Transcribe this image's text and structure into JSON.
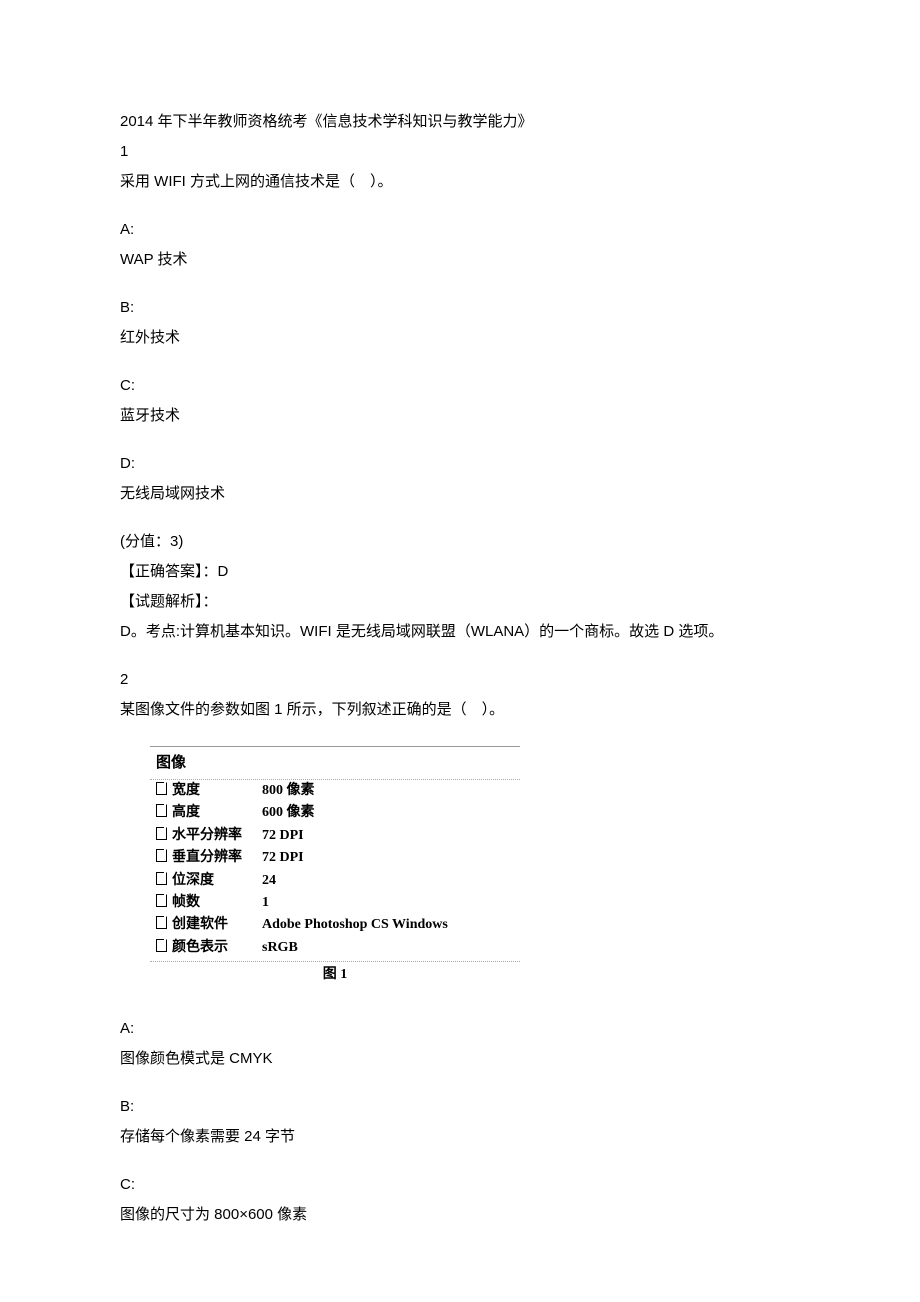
{
  "header": {
    "title": "2014 年下半年教师资格统考《信息技术学科知识与教学能力》"
  },
  "q1": {
    "num": "1",
    "stem": "采用 WIFI 方式上网的通信技术是（　）。",
    "optA_label": "A:",
    "optA_text": "WAP 技术",
    "optB_label": "B:",
    "optB_text": "红外技术",
    "optC_label": "C:",
    "optC_text": "蓝牙技术",
    "optD_label": "D:",
    "optD_text": "无线局域网技术",
    "score": "(分值：3)",
    "answer_label": "【正确答案】：D",
    "analysis_label": "【试题解析】：",
    "analysis_text": "D。考点:计算机基本知识。WIFI 是无线局域网联盟（WLANA）的一个商标。故选 D 选项。"
  },
  "q2": {
    "num": "2",
    "stem": "某图像文件的参数如图 1 所示，下列叙述正确的是（　）。",
    "fig": {
      "header": "图像",
      "rows": [
        {
          "label": "宽度",
          "value": "800 像素"
        },
        {
          "label": "高度",
          "value": "600 像素"
        },
        {
          "label": "水平分辨率",
          "value": "72 DPI"
        },
        {
          "label": "垂直分辨率",
          "value": "72 DPI"
        },
        {
          "label": "位深度",
          "value": "24"
        },
        {
          "label": "帧数",
          "value": "1"
        },
        {
          "label": "创建软件",
          "value": "Adobe Photoshop CS Windows"
        },
        {
          "label": "颜色表示",
          "value": "sRGB"
        }
      ],
      "caption": "图 1"
    },
    "optA_label": "A:",
    "optA_text": "图像颜色模式是 CMYK",
    "optB_label": "B:",
    "optB_text": "存储每个像素需要 24 字节",
    "optC_label": "C:",
    "optC_text": "图像的尺寸为 800×600 像素"
  }
}
